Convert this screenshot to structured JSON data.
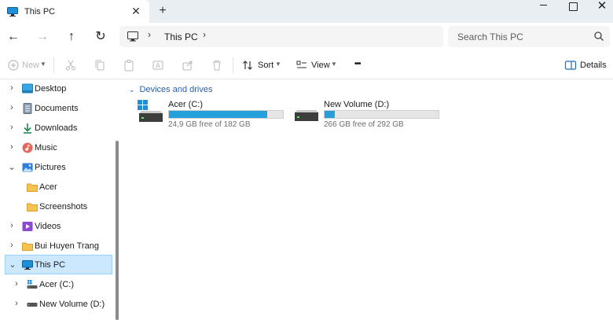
{
  "tab": {
    "title": "This PC",
    "close_glyph": "✕",
    "new_tab_glyph": "+"
  },
  "window": {
    "close_glyph": "✕"
  },
  "nav": {
    "back": "←",
    "forward": "→",
    "up": "↑",
    "refresh": "↻"
  },
  "address": {
    "chevron": "›",
    "path": "This PC"
  },
  "search": {
    "placeholder": "Search This PC"
  },
  "commands": {
    "new": "New",
    "sort": "Sort",
    "view": "View",
    "more": "•••",
    "details": "Details"
  },
  "sidebar": {
    "items": [
      {
        "label": "Desktop",
        "chevron": "›",
        "icon": "desktop-icon"
      },
      {
        "label": "Documents",
        "chevron": "›",
        "icon": "documents-icon"
      },
      {
        "label": "Downloads",
        "chevron": "›",
        "icon": "downloads-icon"
      },
      {
        "label": "Music",
        "chevron": "›",
        "icon": "music-icon"
      },
      {
        "label": "Pictures",
        "chevron": "⌄",
        "icon": "pictures-icon"
      },
      {
        "label": "Acer",
        "chevron": "",
        "icon": "folder-icon"
      },
      {
        "label": "Screenshots",
        "chevron": "",
        "icon": "folder-icon"
      },
      {
        "label": "Videos",
        "chevron": "›",
        "icon": "videos-icon"
      },
      {
        "label": "Bui Huyen Trang",
        "chevron": "›",
        "icon": "folder-icon"
      },
      {
        "label": "This PC",
        "chevron": "⌄",
        "icon": "pc-icon",
        "selected": true
      },
      {
        "label": "Acer (C:)",
        "chevron": "›",
        "icon": "windows-drive-icon"
      },
      {
        "label": "New Volume (D:)",
        "chevron": "›",
        "icon": "drive-icon"
      }
    ]
  },
  "content": {
    "group": {
      "label": "Devices and drives",
      "chevron": "⌄"
    },
    "drives": [
      {
        "name": "Acer (C:)",
        "free_text": "24,9 GB free of 182 GB",
        "used_fraction": 0.863
      },
      {
        "name": "New Volume (D:)",
        "free_text": "266 GB free of 292 GB",
        "used_fraction": 0.089
      }
    ]
  },
  "colors": {
    "accent": "#26a0da",
    "selected_bg": "#cce8ff",
    "group_header": "#2a5fa8"
  }
}
